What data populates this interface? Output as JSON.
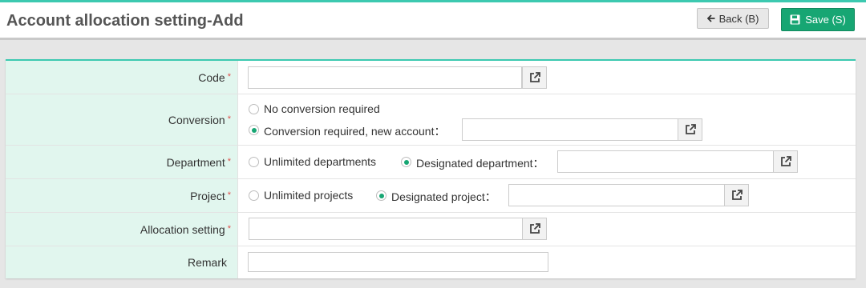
{
  "header": {
    "title": "Account allocation setting-Add",
    "back_label": "Back (B)",
    "save_label": "Save (S)"
  },
  "form": {
    "code": {
      "label": "Code",
      "required_mark": "*",
      "value": ""
    },
    "conversion": {
      "label": "Conversion",
      "required_mark": "*",
      "options": [
        "No conversion required",
        "Conversion required, new account："
      ],
      "selected": 1,
      "account_value": ""
    },
    "department": {
      "label": "Department",
      "required_mark": "*",
      "options": [
        "Unlimited departments",
        "Designated department："
      ],
      "selected": 1,
      "value": ""
    },
    "project": {
      "label": "Project",
      "required_mark": "*",
      "options": [
        "Unlimited projects",
        "Designated project："
      ],
      "selected": 1,
      "value": ""
    },
    "allocation_setting": {
      "label": "Allocation setting",
      "required_mark": "*",
      "value": ""
    },
    "remark": {
      "label": "Remark",
      "value": ""
    }
  },
  "icons": {
    "back": "arrow-left-icon",
    "save": "floppy-disk-icon",
    "lookup": "external-link-icon"
  },
  "colors": {
    "accent": "#3cc9b0",
    "label_bg": "#e1f6ee",
    "primary_button": "#17a673",
    "required": "#e0504d"
  }
}
